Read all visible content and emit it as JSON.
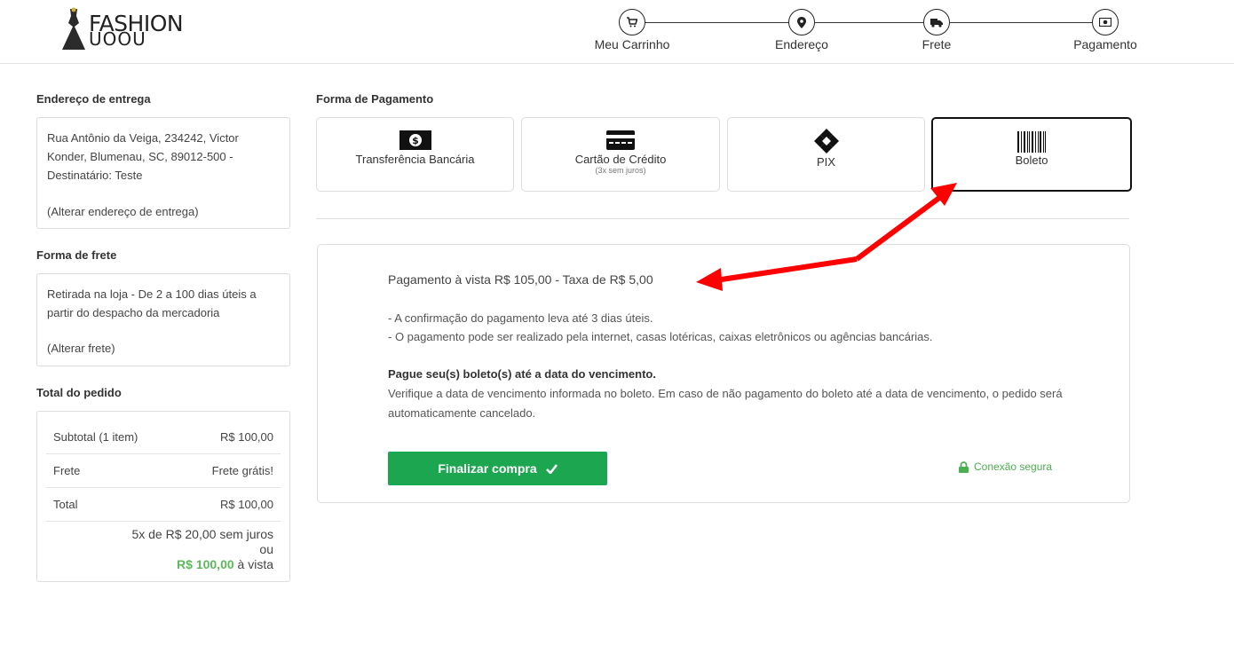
{
  "brand": {
    "line1": "FASHION",
    "line2": "UOOU"
  },
  "steps": [
    {
      "label": "Meu Carrinho",
      "icon": "cart-icon"
    },
    {
      "label": "Endereço",
      "icon": "map-pin-icon"
    },
    {
      "label": "Frete",
      "icon": "truck-icon"
    },
    {
      "label": "Pagamento",
      "icon": "money-icon"
    }
  ],
  "address": {
    "title": "Endereço de entrega",
    "text": "Rua Antônio da Veiga, 234242, Victor Konder, Blumenau, SC, 89012-500 - Destinatário: Teste",
    "change": "(Alterar endereço de entrega)"
  },
  "shipping": {
    "title": "Forma de frete",
    "text": "Retirada na loja - De 2 a 100 dias úteis a partir do despacho da mercadoria",
    "change": "(Alterar frete)"
  },
  "total": {
    "title": "Total do pedido",
    "rows": [
      {
        "label": "Subtotal (1 item)",
        "value": "R$ 100,00"
      },
      {
        "label": "Frete",
        "value": "Frete grátis!"
      },
      {
        "label": "Total",
        "value": "R$ 100,00"
      }
    ],
    "installments": "5x de R$ 20,00 sem juros",
    "or": "ou",
    "cash_value": "R$ 100,00",
    "cash_suffix": " à vista"
  },
  "payment": {
    "title": "Forma de Pagamento",
    "options": [
      {
        "label": "Transferência Bancária",
        "sub": ""
      },
      {
        "label": "Cartão de Crédito",
        "sub": "(3x sem juros)"
      },
      {
        "label": "PIX",
        "sub": ""
      },
      {
        "label": "Boleto",
        "sub": ""
      }
    ],
    "selected": "Boleto"
  },
  "boleto": {
    "price_line": "Pagamento à vista R$ 105,00 - Taxa de R$ 5,00",
    "bullet1": "- A confirmação do pagamento leva até 3 dias úteis.",
    "bullet2": "- O pagamento pode ser realizado pela internet, casas lotéricas, caixas eletrônicos ou agências bancárias.",
    "warn_title": "Pague seu(s) boleto(s) até a data do vencimento.",
    "warn_text": "Verifique a data de vencimento informada no boleto. Em caso de não pagamento do boleto até a data de vencimento, o pedido será automaticamente cancelado.",
    "button": "Finalizar compra",
    "secure": "Conexão segura"
  },
  "colors": {
    "accent": "#1ca650",
    "secure": "#4caf50",
    "annotation": "#ff0000"
  }
}
